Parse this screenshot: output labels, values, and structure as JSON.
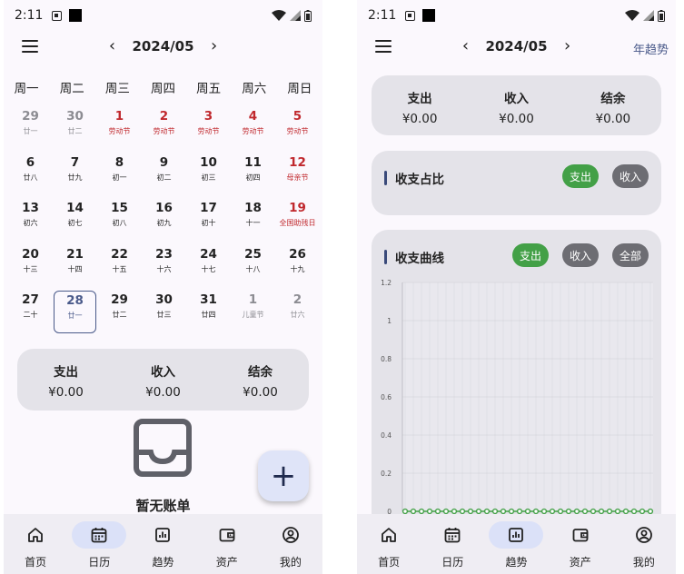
{
  "status": {
    "time": "2:11"
  },
  "calendar_screen": {
    "month": "2024/05",
    "weekdays": [
      "周一",
      "周二",
      "周三",
      "周四",
      "周五",
      "周六",
      "周日"
    ],
    "days": [
      {
        "n": "29",
        "l": "廿一",
        "t": "muted"
      },
      {
        "n": "30",
        "l": "廿二",
        "t": "muted"
      },
      {
        "n": "1",
        "l": "劳动节",
        "t": "red"
      },
      {
        "n": "2",
        "l": "劳动节",
        "t": "red"
      },
      {
        "n": "3",
        "l": "劳动节",
        "t": "red"
      },
      {
        "n": "4",
        "l": "劳动节",
        "t": "red"
      },
      {
        "n": "5",
        "l": "劳动节",
        "t": "red"
      },
      {
        "n": "6",
        "l": "廿八",
        "t": "normal"
      },
      {
        "n": "7",
        "l": "廿九",
        "t": "normal"
      },
      {
        "n": "8",
        "l": "初一",
        "t": "normal"
      },
      {
        "n": "9",
        "l": "初二",
        "t": "normal"
      },
      {
        "n": "10",
        "l": "初三",
        "t": "normal"
      },
      {
        "n": "11",
        "l": "初四",
        "t": "normal"
      },
      {
        "n": "12",
        "l": "母亲节",
        "t": "red"
      },
      {
        "n": "13",
        "l": "初六",
        "t": "normal"
      },
      {
        "n": "14",
        "l": "初七",
        "t": "normal"
      },
      {
        "n": "15",
        "l": "初八",
        "t": "normal"
      },
      {
        "n": "16",
        "l": "初九",
        "t": "normal"
      },
      {
        "n": "17",
        "l": "初十",
        "t": "normal"
      },
      {
        "n": "18",
        "l": "十一",
        "t": "normal"
      },
      {
        "n": "19",
        "l": "全国助残日",
        "t": "red"
      },
      {
        "n": "20",
        "l": "十三",
        "t": "normal"
      },
      {
        "n": "21",
        "l": "十四",
        "t": "normal"
      },
      {
        "n": "22",
        "l": "十五",
        "t": "normal"
      },
      {
        "n": "23",
        "l": "十六",
        "t": "normal"
      },
      {
        "n": "24",
        "l": "十七",
        "t": "normal"
      },
      {
        "n": "25",
        "l": "十八",
        "t": "normal"
      },
      {
        "n": "26",
        "l": "十九",
        "t": "normal"
      },
      {
        "n": "27",
        "l": "二十",
        "t": "normal"
      },
      {
        "n": "28",
        "l": "廿一",
        "t": "normal",
        "selected": true
      },
      {
        "n": "29",
        "l": "廿二",
        "t": "normal"
      },
      {
        "n": "30",
        "l": "廿三",
        "t": "normal"
      },
      {
        "n": "31",
        "l": "廿四",
        "t": "normal"
      },
      {
        "n": "1",
        "l": "儿童节",
        "t": "muted"
      },
      {
        "n": "2",
        "l": "廿六",
        "t": "muted"
      }
    ],
    "summary": {
      "expense_label": "支出",
      "expense": "¥0.00",
      "income_label": "收入",
      "income": "¥0.00",
      "balance_label": "结余",
      "balance": "¥0.00"
    },
    "empty_text": "暂无账单",
    "fab_label": "+"
  },
  "trend_screen": {
    "month": "2024/05",
    "year_trend": "年趋势",
    "summary": {
      "expense_label": "支出",
      "expense": "¥0.00",
      "income_label": "收入",
      "income": "¥0.00",
      "balance_label": "结余",
      "balance": "¥0.00"
    },
    "ratio_title": "收支占比",
    "ratio_chips": [
      "支出",
      "收入"
    ],
    "curve_title": "收支曲线",
    "curve_chips": [
      "支出",
      "收入",
      "全部"
    ]
  },
  "nav": [
    "首页",
    "日历",
    "趋势",
    "资产",
    "我的"
  ],
  "colors": {
    "accent": "#4a5a8a",
    "holiday": "#c0282d",
    "chip_on": "#43a047",
    "chip_off": "#6d6d73",
    "line": "#43a047"
  },
  "chart_data": {
    "type": "line",
    "y_ticks": [
      "1.2",
      "1",
      "0.8",
      "0.6",
      "0.4",
      "0.2",
      "0"
    ],
    "ylim": [
      0,
      1.2
    ],
    "x": [
      1,
      2,
      3,
      4,
      5,
      6,
      7,
      8,
      9,
      10,
      11,
      12,
      13,
      14,
      15,
      16,
      17,
      18,
      19,
      20,
      21,
      22,
      23,
      24,
      25,
      26,
      27,
      28,
      29,
      30,
      31
    ],
    "series": [
      {
        "values": [
          0,
          0,
          0,
          0,
          0,
          0,
          0,
          0,
          0,
          0,
          0,
          0,
          0,
          0,
          0,
          0,
          0,
          0,
          0,
          0,
          0,
          0,
          0,
          0,
          0,
          0,
          0,
          0,
          0,
          0,
          0
        ]
      }
    ]
  }
}
